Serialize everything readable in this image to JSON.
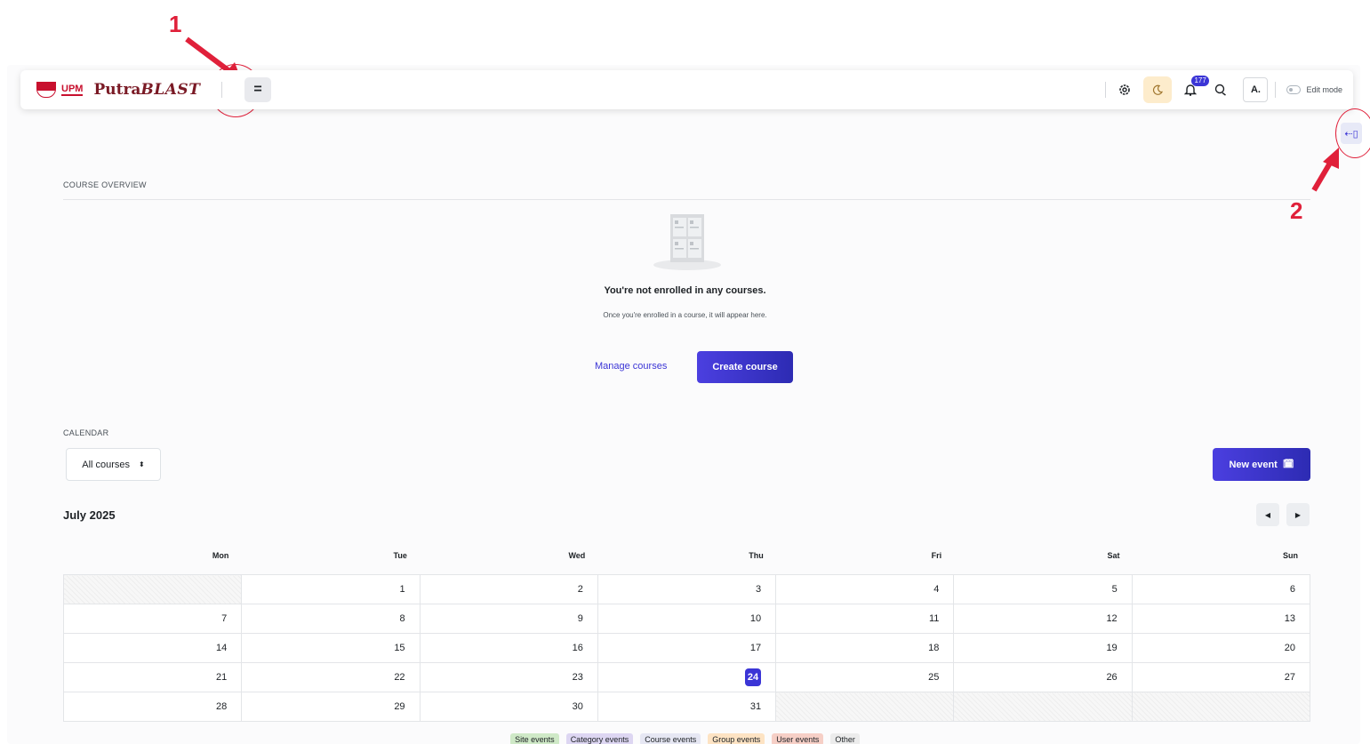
{
  "annotations": {
    "one": "1",
    "two": "2"
  },
  "navbar": {
    "logo_upm": "UPM",
    "logo_text_plain": "Putra",
    "logo_text_italic": "BLAST",
    "drawer_symbol": "=",
    "notification_count": "177",
    "avatar_initial": "A.",
    "edit_mode_label": "Edit mode",
    "icons": [
      "menu-icon",
      "settings-icon",
      "moon-icon",
      "bell-icon",
      "chat-icon",
      "block-drawer-icon"
    ]
  },
  "course_overview": {
    "title": "COURSE OVERVIEW",
    "empty_title": "You're not enrolled in any courses.",
    "empty_subtitle": "Once you're enrolled in a course, it will appear here.",
    "manage_label": "Manage courses",
    "create_label": "Create course"
  },
  "calendar": {
    "title": "CALENDAR",
    "filter_value": "All courses",
    "new_event_label": "New event",
    "month_label": "July 2025",
    "weekdays": [
      "Mon",
      "Tue",
      "Wed",
      "Thu",
      "Fri",
      "Sat",
      "Sun"
    ],
    "weeks": [
      [
        "",
        "1",
        "2",
        "3",
        "4",
        "5",
        "6"
      ],
      [
        "7",
        "8",
        "9",
        "10",
        "11",
        "12",
        "13"
      ],
      [
        "14",
        "15",
        "16",
        "17",
        "18",
        "19",
        "20"
      ],
      [
        "21",
        "22",
        "23",
        "24",
        "25",
        "26",
        "27"
      ],
      [
        "28",
        "29",
        "30",
        "31",
        "",
        "",
        ""
      ]
    ],
    "today": "24",
    "legend": [
      {
        "label": "Site events",
        "color": "#cfe9c7"
      },
      {
        "label": "Category events",
        "color": "#ddd6f2"
      },
      {
        "label": "Course events",
        "color": "#e6e7f3"
      },
      {
        "label": "Group events",
        "color": "#fde3c3"
      },
      {
        "label": "User events",
        "color": "#f6cfc6"
      },
      {
        "label": "Other",
        "color": "#ececec"
      }
    ]
  },
  "colors": {
    "primary": "#3b35d6",
    "annotation": "#e0203a"
  }
}
